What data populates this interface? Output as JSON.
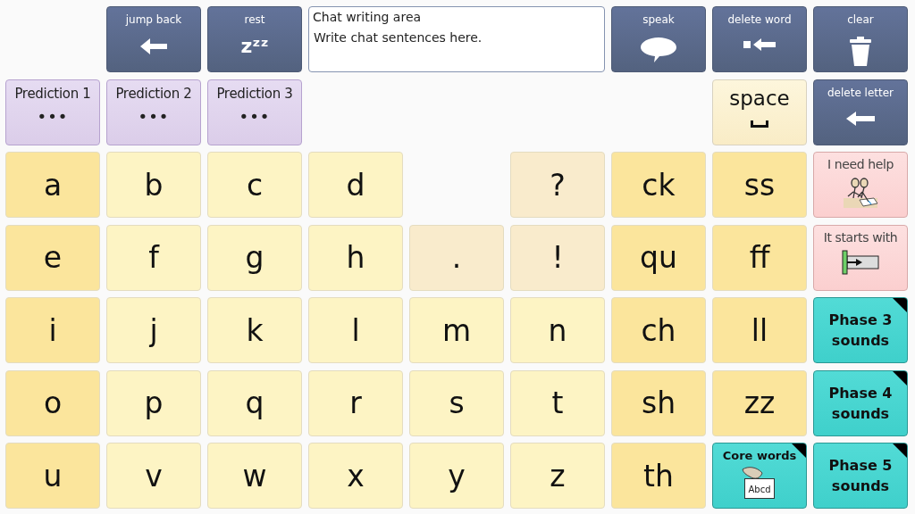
{
  "rows": [
    [
      null,
      {
        "kind": "back",
        "label": "jump back"
      },
      {
        "kind": "rest",
        "label": "rest",
        "symbol": "zᶻᶻ"
      },
      {
        "kind": "chat",
        "title": "Chat writing area",
        "placeholder": "Write chat sentences here."
      },
      {
        "kind": "speak",
        "label": "speak"
      },
      {
        "kind": "deleteword",
        "label": "delete word"
      },
      {
        "kind": "clear",
        "label": "clear"
      }
    ],
    [
      {
        "kind": "prediction",
        "label": "Prediction 1",
        "symbol": "•••"
      },
      {
        "kind": "prediction",
        "label": "Prediction 2",
        "symbol": "•••"
      },
      {
        "kind": "prediction",
        "label": "Prediction 3",
        "symbol": "•••"
      },
      null,
      null,
      null,
      null,
      {
        "kind": "space",
        "label": "space"
      },
      {
        "kind": "deleteletter",
        "label": "delete letter"
      }
    ],
    [
      {
        "kind": "letter",
        "label": "a",
        "color": "#fbe59c"
      },
      {
        "kind": "letter",
        "label": "b",
        "color": "#fdf4c4"
      },
      {
        "kind": "letter",
        "label": "c",
        "color": "#fdf4c4"
      },
      {
        "kind": "letter",
        "label": "d",
        "color": "#fdf4c4"
      },
      null,
      {
        "kind": "letter",
        "label": "?",
        "color": "#f9ebcc"
      },
      {
        "kind": "letter",
        "label": "ck",
        "color": "#fbe59c"
      },
      {
        "kind": "letter",
        "label": "ss",
        "color": "#fbe59c"
      },
      {
        "kind": "help",
        "label": "I need help"
      }
    ],
    [
      {
        "kind": "letter",
        "label": "e",
        "color": "#fbe59c"
      },
      {
        "kind": "letter",
        "label": "f",
        "color": "#fdf4c4"
      },
      {
        "kind": "letter",
        "label": "g",
        "color": "#fdf4c4"
      },
      {
        "kind": "letter",
        "label": "h",
        "color": "#fdf4c4"
      },
      {
        "kind": "letter",
        "label": ".",
        "color": "#f9ebcc"
      },
      {
        "kind": "letter",
        "label": "!",
        "color": "#f9ebcc"
      },
      {
        "kind": "letter",
        "label": "qu",
        "color": "#fbe59c"
      },
      {
        "kind": "letter",
        "label": "ff",
        "color": "#fbe59c"
      },
      {
        "kind": "startswith",
        "label": "It starts with"
      }
    ],
    [
      {
        "kind": "letter",
        "label": "i",
        "color": "#fbe59c"
      },
      {
        "kind": "letter",
        "label": "j",
        "color": "#fdf4c4"
      },
      {
        "kind": "letter",
        "label": "k",
        "color": "#fdf4c4"
      },
      {
        "kind": "letter",
        "label": "l",
        "color": "#fdf4c4"
      },
      {
        "kind": "letter",
        "label": "m",
        "color": "#fdf4c4"
      },
      {
        "kind": "letter",
        "label": "n",
        "color": "#fdf4c4"
      },
      {
        "kind": "letter",
        "label": "ch",
        "color": "#fbe59c"
      },
      {
        "kind": "letter",
        "label": "ll",
        "color": "#fbe59c"
      },
      {
        "kind": "folder",
        "label": "Phase 3 sounds"
      }
    ],
    [
      {
        "kind": "letter",
        "label": "o",
        "color": "#fbe59c"
      },
      {
        "kind": "letter",
        "label": "p",
        "color": "#fdf4c4"
      },
      {
        "kind": "letter",
        "label": "q",
        "color": "#fdf4c4"
      },
      {
        "kind": "letter",
        "label": "r",
        "color": "#fdf4c4"
      },
      {
        "kind": "letter",
        "label": "s",
        "color": "#fdf4c4"
      },
      {
        "kind": "letter",
        "label": "t",
        "color": "#fdf4c4"
      },
      {
        "kind": "letter",
        "label": "sh",
        "color": "#fbe59c"
      },
      {
        "kind": "letter",
        "label": "zz",
        "color": "#fbe59c"
      },
      {
        "kind": "folder",
        "label": "Phase 4 sounds"
      }
    ],
    [
      {
        "kind": "letter",
        "label": "u",
        "color": "#fbe59c"
      },
      {
        "kind": "letter",
        "label": "v",
        "color": "#fdf4c4"
      },
      {
        "kind": "letter",
        "label": "w",
        "color": "#fdf4c4"
      },
      {
        "kind": "letter",
        "label": "x",
        "color": "#fdf4c4"
      },
      {
        "kind": "letter",
        "label": "y",
        "color": "#fdf4c4"
      },
      {
        "kind": "letter",
        "label": "z",
        "color": "#fdf4c4"
      },
      {
        "kind": "letter",
        "label": "th",
        "color": "#fbe59c"
      },
      {
        "kind": "corewords",
        "label": "Core words",
        "card_text": "Abcd"
      },
      {
        "kind": "folder",
        "label": "Phase 5 sounds"
      }
    ]
  ]
}
